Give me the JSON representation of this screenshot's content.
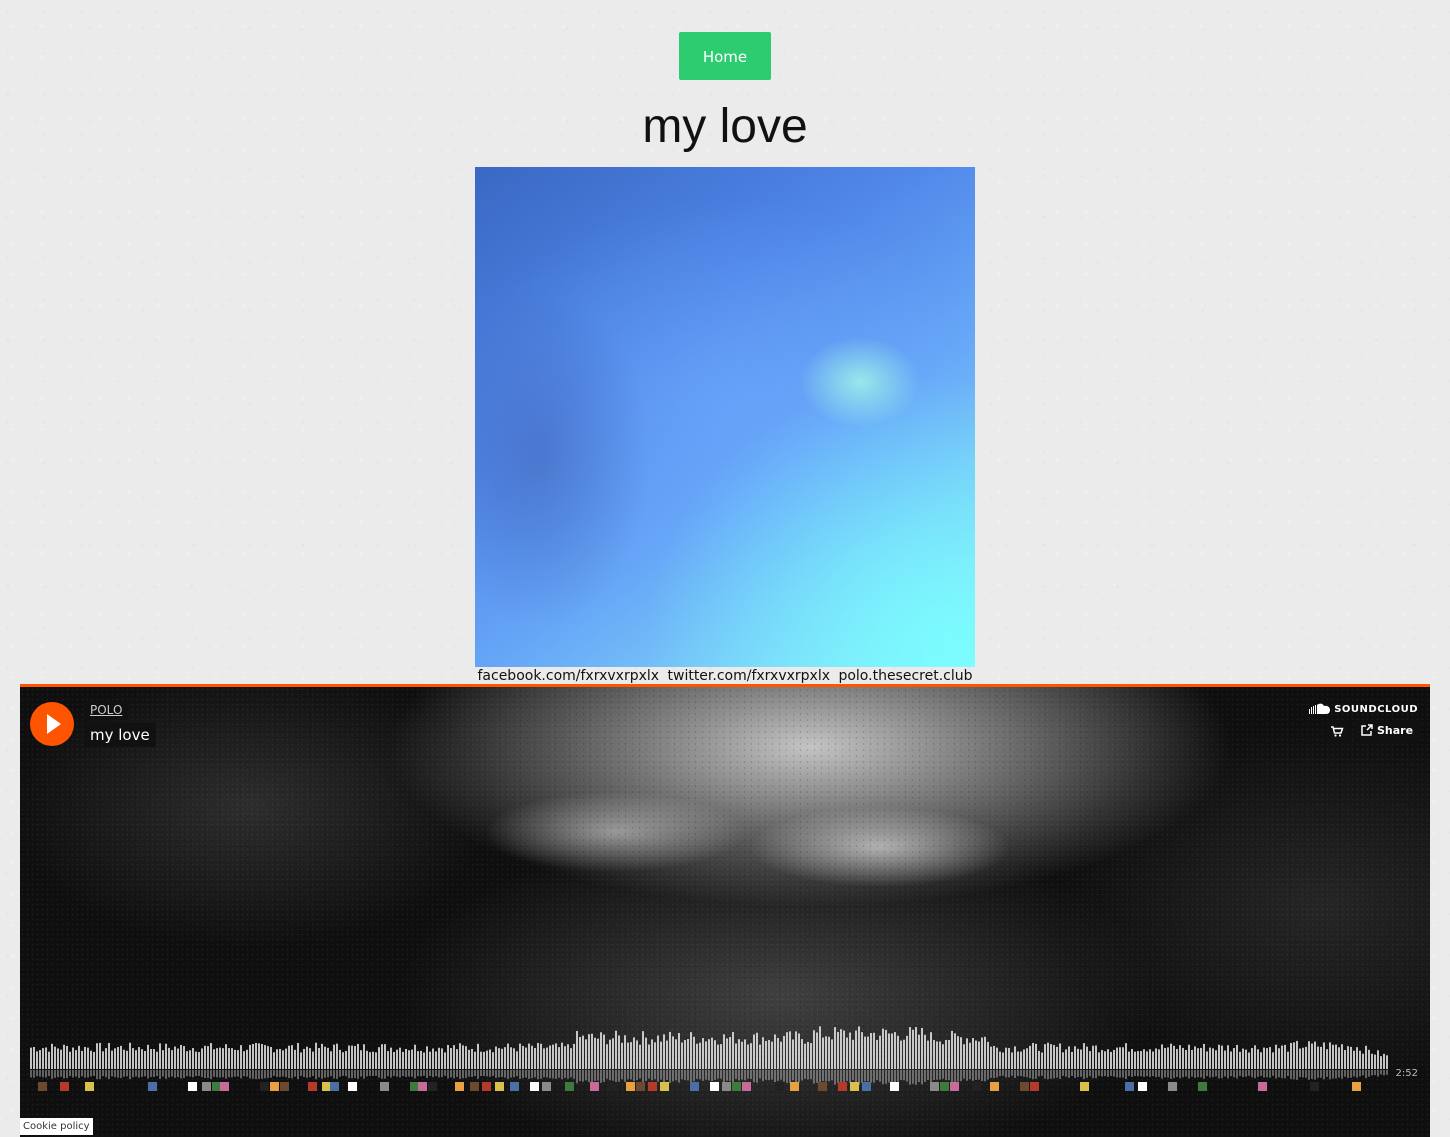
{
  "nav": {
    "home_label": "Home"
  },
  "page": {
    "title": "my love"
  },
  "social": {
    "facebook": "facebook.com/fxrxvxrpxlx",
    "twitter": "twitter.com/fxrxvxrpxlx",
    "site": "polo.thesecret.club"
  },
  "player": {
    "artist": "POLO",
    "track_title": "my love",
    "brand": "SOUNDCLOUD",
    "share_label": "Share",
    "duration": "2:52",
    "accent_color": "#ff5500",
    "icons": [
      "play-icon",
      "soundcloud-logo-icon",
      "cart-icon",
      "share-icon"
    ]
  },
  "footer": {
    "cookie_label": "Cookie policy"
  },
  "colors": {
    "home_button": "#2ecc71",
    "background": "#ebebeb"
  }
}
